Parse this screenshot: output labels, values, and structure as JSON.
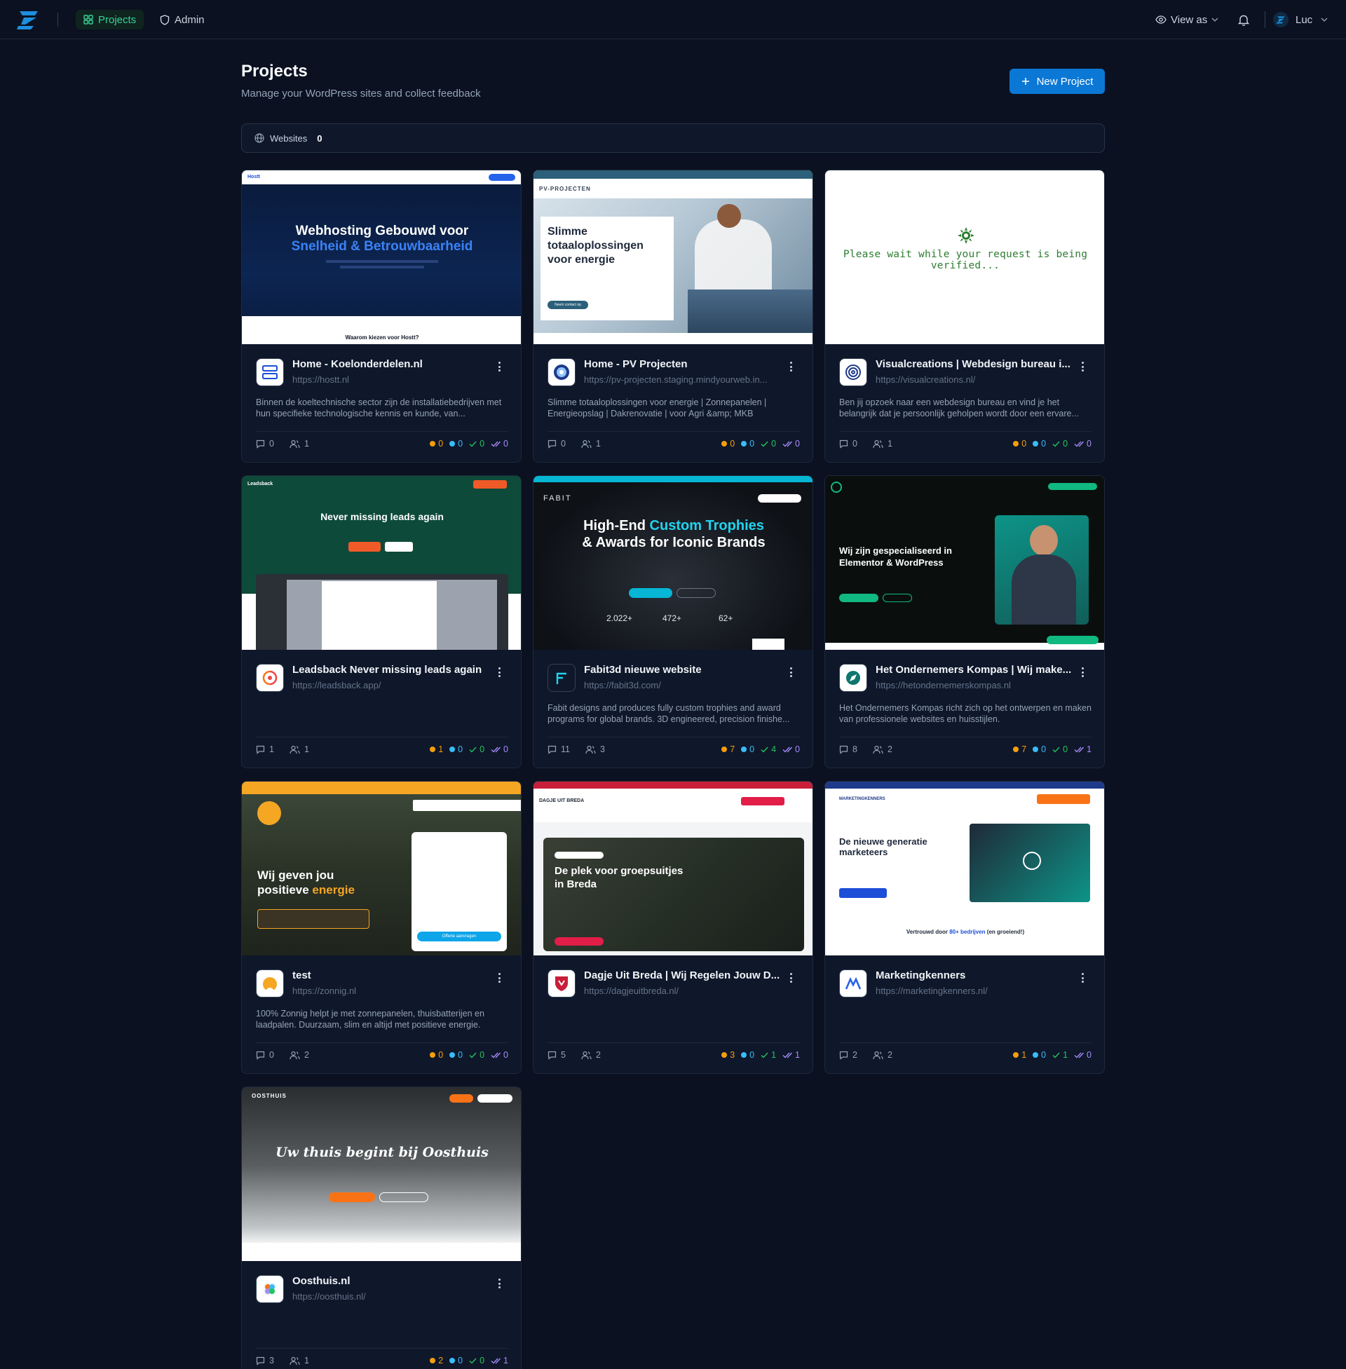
{
  "nav": {
    "projects": "Projects",
    "admin": "Admin",
    "view_as": "View as",
    "user": "Luc"
  },
  "header": {
    "title": "Projects",
    "subtitle": "Manage your WordPress sites and collect feedback",
    "new_button": "New Project"
  },
  "websites": {
    "label": "Websites",
    "count": "0"
  },
  "colors": {
    "accent": "#0b78d6",
    "active_nav": "#34d399",
    "open": "#f59e0b",
    "in_progress": "#38bdf8",
    "resolved": "#22c55e",
    "verified": "#a78bfa"
  },
  "projects": [
    {
      "title": "Home - Koelonderdelen.nl",
      "url": "https://hostt.nl",
      "description": "Binnen de koeltechnische sector zijn de installatiebedrijven met hun specifieke technologische kennis en kunde, van...",
      "comments": "0",
      "members": "1",
      "open": "0",
      "progress": "0",
      "resolved": "0",
      "verified": "0",
      "thumb": {
        "brand": "Hostt",
        "headline1": "Webhosting Gebouwd voor",
        "headline2": "Snelheid & Betrouwbaarheid",
        "footer": "Waarom kiezen voor Hostt?"
      }
    },
    {
      "title": "Home - PV Projecten",
      "url": "https://pv-projecten.staging.mindyourweb.in...",
      "description": "Slimme totaaloplossingen voor energie | Zonnepanelen | Energieopslag | Dakrenovatie | voor Agri &amp; MKB",
      "comments": "0",
      "members": "1",
      "open": "0",
      "progress": "0",
      "resolved": "0",
      "verified": "0",
      "thumb": {
        "brand": "PV-PROJECTEN",
        "headline": "Slimme totaaloplossingen voor energie",
        "button": "Neem contact op"
      }
    },
    {
      "title": "Visualcreations | Webdesign bureau i...",
      "url": "https://visualcreations.nl/",
      "description": "Ben jij opzoek naar een webdesign bureau en vind je het belangrijk dat je persoonlijk geholpen wordt door een ervare...",
      "comments": "0",
      "members": "1",
      "open": "0",
      "progress": "0",
      "resolved": "0",
      "verified": "0",
      "thumb": {
        "message": "Please wait while your request is being verified..."
      }
    },
    {
      "title": "Leadsback Never missing leads again",
      "url": "https://leadsback.app/",
      "description": "",
      "comments": "1",
      "members": "1",
      "open": "1",
      "progress": "0",
      "resolved": "0",
      "verified": "0",
      "thumb": {
        "brand": "Leadsback",
        "headline": "Never missing leads again"
      }
    },
    {
      "title": "Fabit3d nieuwe website",
      "url": "https://fabit3d.com/",
      "description": "Fabit designs and produces fully custom trophies and award programs for global brands. 3D engineered, precision finishe...",
      "comments": "11",
      "members": "3",
      "open": "7",
      "progress": "0",
      "resolved": "4",
      "verified": "0",
      "thumb": {
        "brand": "FABIT",
        "headline1a": "High-End ",
        "headline1b": "Custom Trophies",
        "headline2": "& Awards for Iconic Brands",
        "s1": "2.022+",
        "s2": "472+",
        "s3": "62+"
      }
    },
    {
      "title": "Het Ondernemers Kompas | Wij make...",
      "url": "https://hetondernemerskompas.nl",
      "description": "Het Ondernemers Kompas richt zich op het ontwerpen en maken van professionele websites en huisstijlen.",
      "comments": "8",
      "members": "2",
      "open": "7",
      "progress": "0",
      "resolved": "0",
      "verified": "1",
      "thumb": {
        "headline": "Wij zijn gespecialiseerd in Elementor & WordPress"
      }
    },
    {
      "title": "test",
      "url": "https://zonnig.nl",
      "description": "100% Zonnig helpt je met zonnepanelen, thuisbatterijen en laadpalen. Duurzaam, slim en altijd met positieve energie.",
      "comments": "0",
      "members": "2",
      "open": "0",
      "progress": "0",
      "resolved": "0",
      "verified": "0",
      "thumb": {
        "headline1": "Wij geven jou",
        "headline2a": "positieve ",
        "headline2b": "energie",
        "button": "Offerte aanvragen"
      }
    },
    {
      "title": "Dagje Uit Breda | Wij Regelen Jouw D...",
      "url": "https://dagjeuitbreda.nl/",
      "description": "",
      "comments": "5",
      "members": "2",
      "open": "3",
      "progress": "0",
      "resolved": "1",
      "verified": "1",
      "thumb": {
        "brand": "DAGJE UIT BREDA",
        "headline": "De plek voor groepsuitjes in Breda"
      }
    },
    {
      "title": "Marketingkenners",
      "url": "https://marketingkenners.nl/",
      "description": "",
      "comments": "2",
      "members": "2",
      "open": "1",
      "progress": "0",
      "resolved": "1",
      "verified": "0",
      "thumb": {
        "brand": "MARKETINGKENNERS",
        "headline": "De nieuwe generatie marketeers",
        "footer1": "Vertrouwd door ",
        "footer2": "80+ bedrijven",
        "footer3": " (en groeiend!)"
      }
    },
    {
      "title": "Oosthuis.nl",
      "url": "https://oosthuis.nl/",
      "description": "",
      "comments": "3",
      "members": "1",
      "open": "2",
      "progress": "0",
      "resolved": "0",
      "verified": "1",
      "thumb": {
        "brand": "OOSTHUIS",
        "headline": "Uw thuis begint bij Oosthuis"
      }
    }
  ]
}
